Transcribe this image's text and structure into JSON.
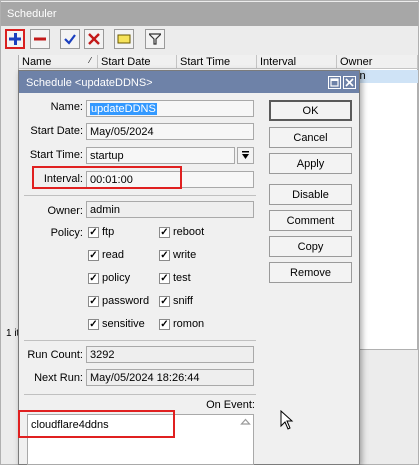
{
  "scheduler": {
    "title": "Scheduler",
    "columns": [
      "Name",
      "Start Date",
      "Start Time",
      "Interval",
      "Owner"
    ],
    "selected_row_partial": "in",
    "status_partial": "1 it"
  },
  "dialog": {
    "title": "Schedule <updateDDNS>",
    "name_label": "Name:",
    "name_value": "updateDDNS",
    "start_date_label": "Start Date:",
    "start_date_value": "May/05/2024",
    "start_time_label": "Start Time:",
    "start_time_value": "startup",
    "interval_label": "Interval:",
    "interval_value": "00:01:00",
    "owner_label": "Owner:",
    "owner_value": "admin",
    "policy_label": "Policy:",
    "policies": [
      {
        "label": "ftp",
        "checked": true
      },
      {
        "label": "reboot",
        "checked": true
      },
      {
        "label": "read",
        "checked": true
      },
      {
        "label": "write",
        "checked": true
      },
      {
        "label": "policy",
        "checked": true
      },
      {
        "label": "test",
        "checked": true
      },
      {
        "label": "password",
        "checked": true
      },
      {
        "label": "sniff",
        "checked": true
      },
      {
        "label": "sensitive",
        "checked": true
      },
      {
        "label": "romon",
        "checked": true
      }
    ],
    "run_count_label": "Run Count:",
    "run_count_value": "3292",
    "next_run_label": "Next Run:",
    "next_run_value": "May/05/2024 18:26:44",
    "on_event_label": "On Event:",
    "on_event_value": "cloudflare4ddns",
    "buttons": {
      "ok": "OK",
      "cancel": "Cancel",
      "apply": "Apply",
      "disable": "Disable",
      "comment": "Comment",
      "copy": "Copy",
      "remove": "Remove"
    }
  },
  "icons": [
    "add-icon",
    "remove-icon",
    "enable-check-icon",
    "disable-x-icon",
    "comment-note-icon",
    "filter-icon",
    "dropdown-arrow-icon",
    "restore-icon",
    "close-icon",
    "mouse-cursor-icon"
  ],
  "colors": {
    "highlight": "#e02020",
    "title_bar": "#6e82a8",
    "selection": "#3399ff"
  }
}
